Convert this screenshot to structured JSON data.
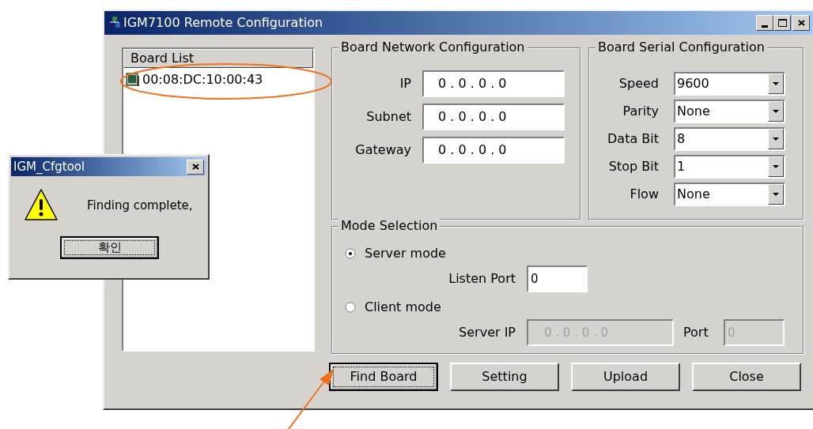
{
  "window": {
    "title": "IGM7100 Remote Configuration"
  },
  "board_list": {
    "header": "Board List",
    "items": [
      {
        "label": "00:08:DC:10:00:43"
      }
    ]
  },
  "network": {
    "title": "Board Network Configuration",
    "fields": [
      {
        "label": "IP",
        "value": "0 . 0 . 0 . 0"
      },
      {
        "label": "Subnet",
        "value": "0 . 0 . 0 . 0"
      },
      {
        "label": "Gateway",
        "value": "0 . 0 . 0 . 0"
      }
    ]
  },
  "serial": {
    "title": "Board Serial Configuration",
    "fields": [
      {
        "label": "Speed",
        "value": "9600"
      },
      {
        "label": "Parity",
        "value": "None"
      },
      {
        "label": "Data Bit",
        "value": "8"
      },
      {
        "label": "Stop Bit",
        "value": "1"
      },
      {
        "label": "Flow",
        "value": "None"
      }
    ]
  },
  "mode": {
    "title": "Mode Selection",
    "options": [
      {
        "label": "Server mode",
        "selected": true,
        "fields": [
          {
            "label": "Listen Port",
            "value": "0",
            "disabled": false,
            "kind": "port"
          }
        ]
      },
      {
        "label": "Client mode",
        "selected": false,
        "fields": [
          {
            "label": "Server IP",
            "value": "0 . 0 . 0 . 0",
            "disabled": true,
            "kind": "ip"
          },
          {
            "label": "Port",
            "value": "0",
            "disabled": true,
            "kind": "port"
          }
        ]
      }
    ]
  },
  "buttons": [
    {
      "label": "Find Board",
      "focused": true
    },
    {
      "label": "Setting",
      "focused": false
    },
    {
      "label": "Upload",
      "focused": false
    },
    {
      "label": "Close",
      "focused": false
    }
  ],
  "dialog": {
    "title": "IGM_Cfgtool",
    "message": "Finding complete,",
    "button": "확인"
  }
}
